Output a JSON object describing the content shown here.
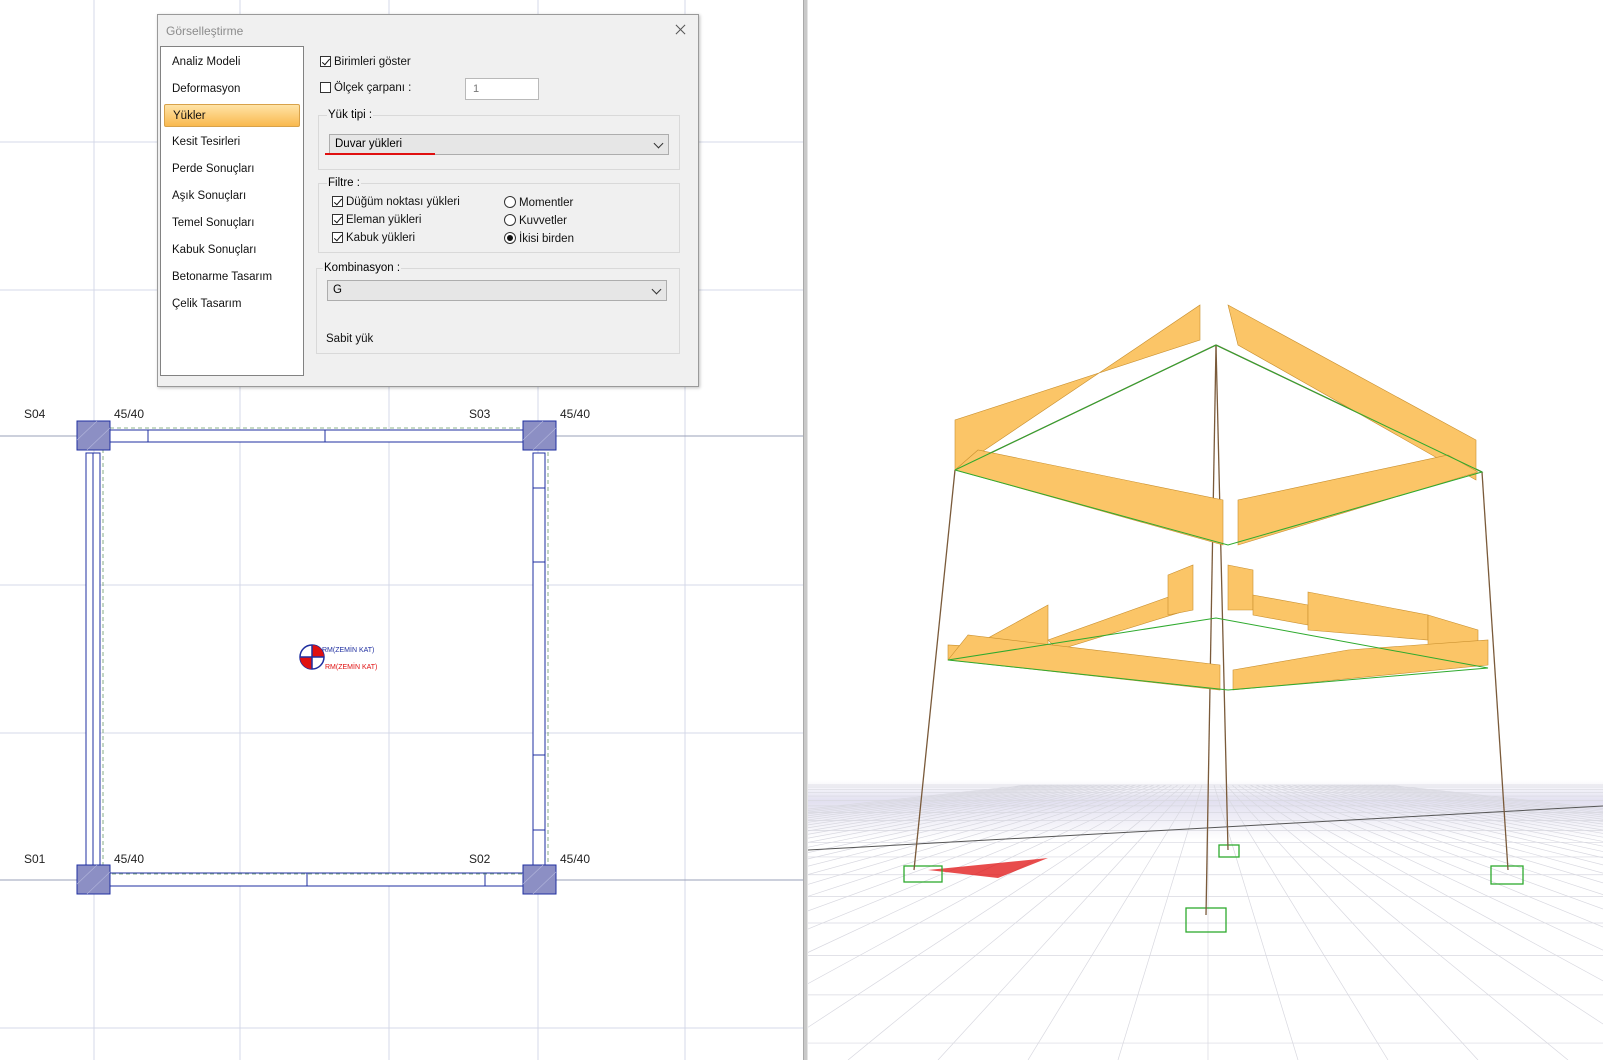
{
  "dialog": {
    "title": "Görselleştirme",
    "nav_items": [
      {
        "label": "Analiz Modeli"
      },
      {
        "label": "Deformasyon"
      },
      {
        "label": "Yükler",
        "selected": true
      },
      {
        "label": "Kesit Tesirleri"
      },
      {
        "label": "Perde Sonuçları"
      },
      {
        "label": "Aşık Sonuçları"
      },
      {
        "label": "Temel Sonuçları"
      },
      {
        "label": "Kabuk Sonuçları"
      },
      {
        "label": "Betonarme Tasarım"
      },
      {
        "label": "Çelik Tasarım"
      }
    ],
    "show_units": {
      "label": "Birimleri göster",
      "checked": true
    },
    "scale_factor": {
      "label": "Ölçek çarpanı :",
      "checked": false,
      "value": "1"
    },
    "load_type": {
      "title": "Yük tipi :",
      "selected": "Duvar yükleri"
    },
    "filter": {
      "title": "Filtre :",
      "checkboxes": [
        {
          "label": "Düğüm noktası yükleri",
          "checked": true
        },
        {
          "label": "Eleman yükleri",
          "checked": true
        },
        {
          "label": "Kabuk yükleri",
          "checked": true
        }
      ],
      "radios": [
        {
          "label": "Momentler",
          "checked": false
        },
        {
          "label": "Kuvvetler",
          "checked": false
        },
        {
          "label": "İkisi birden",
          "checked": true
        }
      ]
    },
    "combination": {
      "title": "Kombinasyon :",
      "selected": "G",
      "description": "Sabit yük"
    }
  },
  "plan": {
    "columns": [
      {
        "name": "S04",
        "size": "45/40"
      },
      {
        "name": "S03",
        "size": "45/40"
      },
      {
        "name": "S01",
        "size": "45/40"
      },
      {
        "name": "S02",
        "size": "45/40"
      }
    ],
    "center_label_1": "RM(ZEMİN KAT)",
    "center_label_2": "RM(ZEMİN KAT)"
  },
  "colors": {
    "plan_blue": "#1f2fa0",
    "column_fill": "#8c8fc4",
    "load_fill": "#fbc567",
    "frame_brown": "#7a5a3a",
    "support_green": "#2eaa2e",
    "nav_selected": "#f9b94f",
    "highlight_red": "#e01010"
  }
}
